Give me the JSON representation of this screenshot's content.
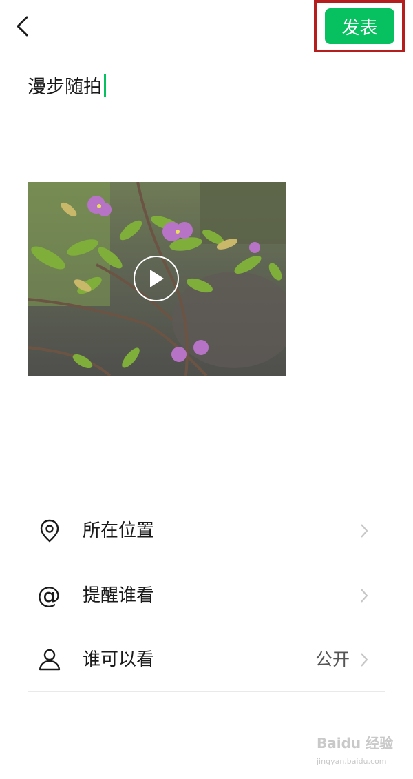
{
  "header": {
    "publish_label": "发表"
  },
  "post": {
    "text": "漫步随拍"
  },
  "options": [
    {
      "label": "所在位置",
      "icon": "location-pin-icon",
      "value": ""
    },
    {
      "label": "提醒谁看",
      "icon": "at-sign-icon",
      "value": ""
    },
    {
      "label": "谁可以看",
      "icon": "person-icon",
      "value": "公开"
    }
  ],
  "watermark": {
    "brand": "Baidu 经验",
    "site": "jingyan.baidu.com"
  },
  "colors": {
    "accent": "#07c160",
    "highlight_box": "#b41e1e"
  }
}
